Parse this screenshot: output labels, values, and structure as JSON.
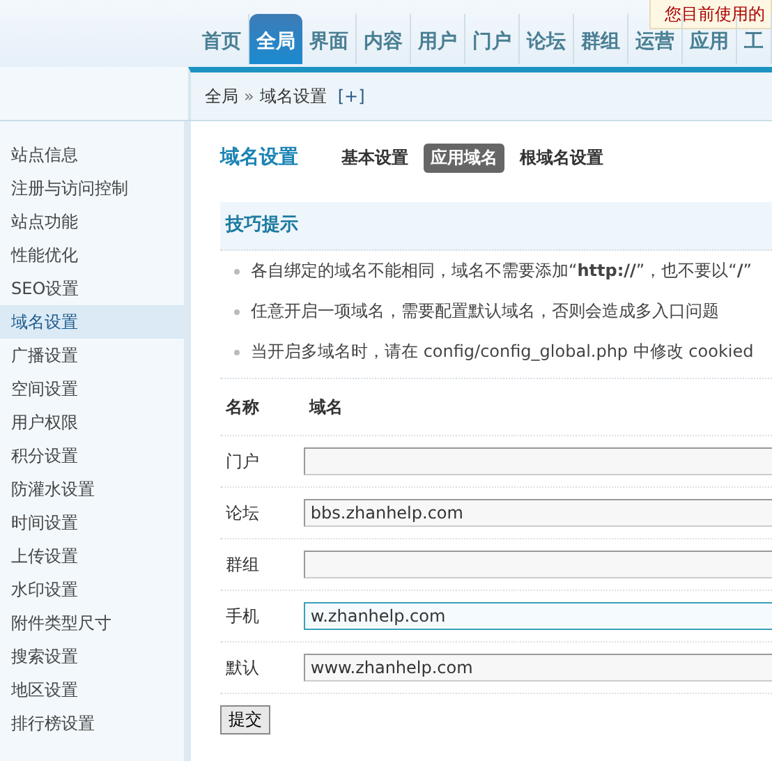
{
  "notice": "您目前使用的",
  "nav": [
    {
      "label": "首页",
      "selected": false
    },
    {
      "label": "全局",
      "selected": true
    },
    {
      "label": "界面",
      "selected": false
    },
    {
      "label": "内容",
      "selected": false
    },
    {
      "label": "用户",
      "selected": false
    },
    {
      "label": "门户",
      "selected": false
    },
    {
      "label": "论坛",
      "selected": false
    },
    {
      "label": "群组",
      "selected": false
    },
    {
      "label": "运营",
      "selected": false
    },
    {
      "label": "应用",
      "selected": false
    },
    {
      "label": "工",
      "selected": false
    }
  ],
  "breadcrumb": {
    "items": [
      "全局",
      "域名设置"
    ],
    "separator": "»",
    "add": "[+]"
  },
  "sidebar": {
    "items": [
      {
        "label": "站点信息",
        "selected": false
      },
      {
        "label": "注册与访问控制",
        "selected": false
      },
      {
        "label": "站点功能",
        "selected": false
      },
      {
        "label": "性能优化",
        "selected": false
      },
      {
        "label": "SEO设置",
        "selected": false
      },
      {
        "label": "域名设置",
        "selected": true
      },
      {
        "label": "广播设置",
        "selected": false
      },
      {
        "label": "空间设置",
        "selected": false
      },
      {
        "label": "用户权限",
        "selected": false
      },
      {
        "label": "积分设置",
        "selected": false
      },
      {
        "label": "防灌水设置",
        "selected": false
      },
      {
        "label": "时间设置",
        "selected": false
      },
      {
        "label": "上传设置",
        "selected": false
      },
      {
        "label": "水印设置",
        "selected": false
      },
      {
        "label": "附件类型尺寸",
        "selected": false
      },
      {
        "label": "搜索设置",
        "selected": false
      },
      {
        "label": "地区设置",
        "selected": false
      },
      {
        "label": "排行榜设置",
        "selected": false
      }
    ]
  },
  "page": {
    "title": "域名设置",
    "tabs": [
      {
        "label": "基本设置",
        "selected": false
      },
      {
        "label": "应用域名",
        "selected": true
      },
      {
        "label": "根域名设置",
        "selected": false
      }
    ]
  },
  "tips": {
    "title": "技巧提示",
    "items": [
      "各自绑定的域名不能相同，域名不需要添加“**http://**”，也不要以“**/**”",
      "任意开启一项域名，需要配置默认域名，否则会造成多入口问题",
      "当开启多域名时，请在 config/config_global.php 中修改 cookied"
    ]
  },
  "table": {
    "columns": [
      "名称",
      "域名"
    ],
    "rows": [
      {
        "name": "门户",
        "focused": false
      },
      {
        "name": "论坛",
        "value": "bbs.zhanhelp.com",
        "focused": false
      },
      {
        "name": "群组",
        "focused": false
      },
      {
        "name": "手机",
        "value": "w.zhanhelp.com",
        "focused": true
      },
      {
        "name": "默认",
        "value": "www.zhanhelp.com",
        "focused": false
      }
    ]
  },
  "submit": "提交"
}
